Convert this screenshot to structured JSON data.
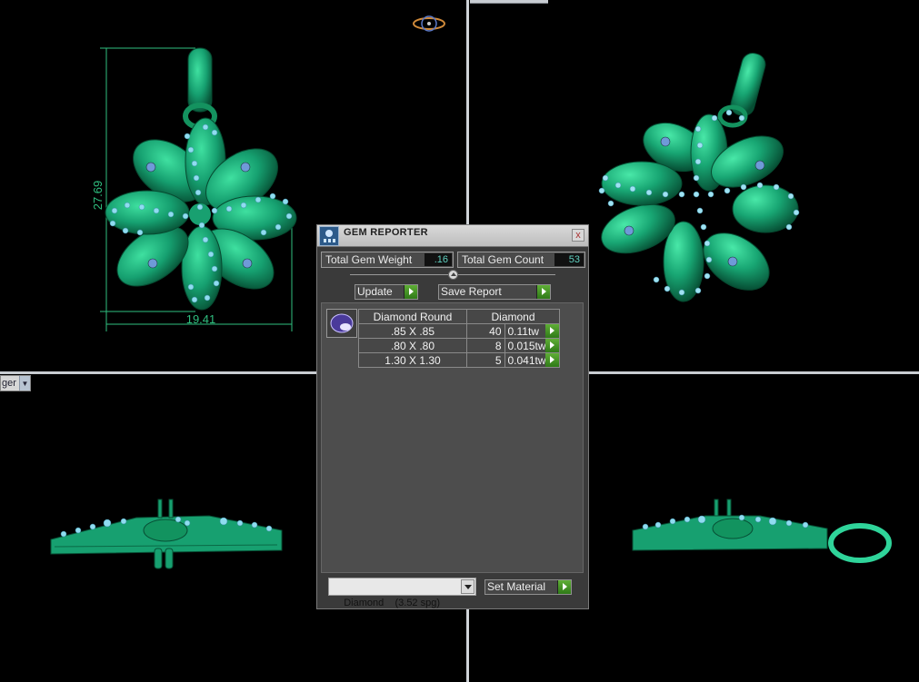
{
  "viewports": {
    "top_left": {
      "height_dimension": "27.69",
      "width_dimension": "19.41"
    },
    "bottom_left": {
      "dropdown_label": "ger"
    }
  },
  "colors": {
    "metal": "#1f9e6f",
    "metal_dark": "#0b5e40",
    "gem": "#7fd7ee",
    "dimension_line": "#2fbf7f",
    "panel_bg": "#3a3a3a",
    "go_button": "#4a9a2a"
  },
  "gem_reporter": {
    "title": "GEM REPORTER",
    "close_label": "x",
    "total_weight_label": "Total Gem Weight",
    "total_weight_value": ".16",
    "total_count_label": "Total Gem Count",
    "total_count_value": "53",
    "update_label": "Update",
    "save_report_label": "Save Report",
    "table": {
      "header_shape": "Diamond Round",
      "header_material": "Diamond",
      "rows": [
        {
          "size": ".85 X .85",
          "count": "40",
          "weight": "0.11tw"
        },
        {
          "size": ".80 X .80",
          "count": "8",
          "weight": "0.015tw"
        },
        {
          "size": "1.30 X 1.30",
          "count": "5",
          "weight": "0.041tw"
        }
      ]
    },
    "material_select": "Diamond    (3.52 spg)",
    "set_material_label": "Set Material"
  },
  "icons": {
    "panel": "gem-reporter-icon",
    "gem_shape": "round-diamond-icon",
    "close": "close-icon",
    "go": "green-arrow-icon"
  }
}
